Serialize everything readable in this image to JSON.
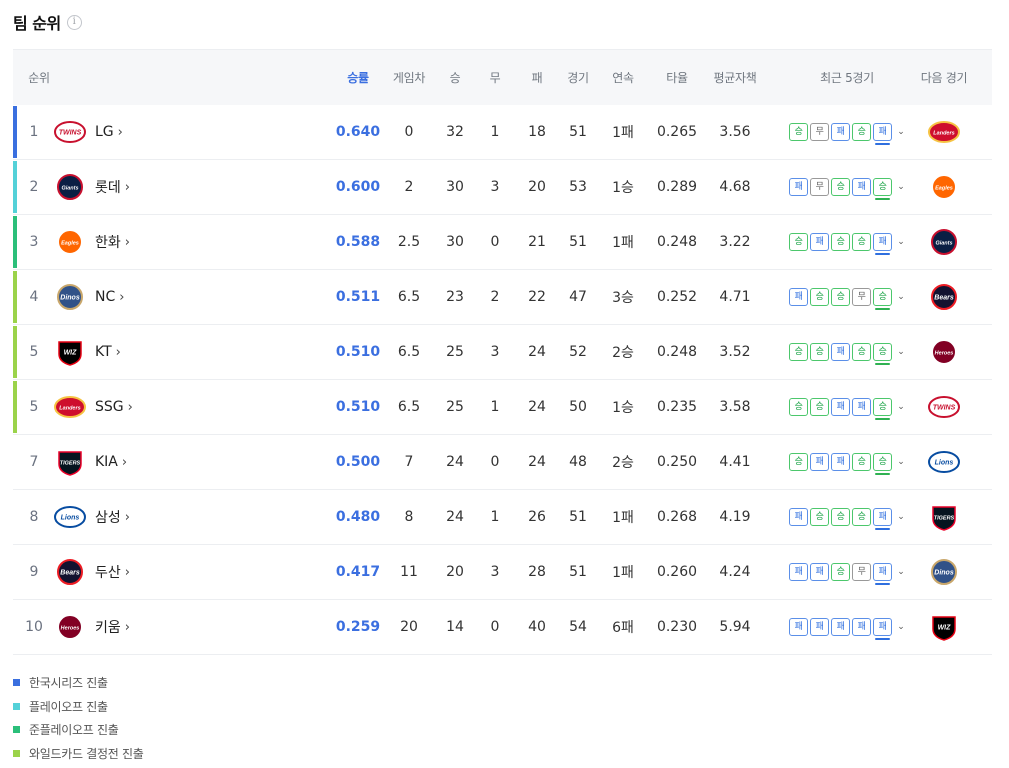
{
  "title": "팀 순위",
  "info_icon": "i",
  "colors": {
    "korean_series": "#3a6fdf",
    "playoff": "#54d1d8",
    "semi_playoff": "#2bbf7a",
    "wildcard": "#9bd34a",
    "win": "#1fa64a",
    "lose": "#2f6fdf",
    "draw": "#666666",
    "accent": "#3b6fe0"
  },
  "headers": {
    "rank": "순위",
    "pct": "승률",
    "gb": "게임차",
    "win": "승",
    "draw": "무",
    "lose": "패",
    "games": "경기",
    "streak": "연속",
    "avg": "타율",
    "era": "평균자책",
    "last5": "최근 5경기",
    "next": "다음 경기"
  },
  "rows": [
    {
      "rank": "1",
      "team": "LG",
      "pct": "0.640",
      "gb": "0",
      "w": "32",
      "d": "1",
      "l": "18",
      "g": "51",
      "streak": "1패",
      "avg": "0.265",
      "era": "3.56",
      "last5": [
        "승",
        "무",
        "패",
        "승",
        "패"
      ],
      "logo": "lg-twins-logo-icon",
      "next_logo": "ssg-landers-logo-icon",
      "bar": "korean_series"
    },
    {
      "rank": "2",
      "team": "롯데",
      "pct": "0.600",
      "gb": "2",
      "w": "30",
      "d": "3",
      "l": "20",
      "g": "53",
      "streak": "1승",
      "avg": "0.289",
      "era": "4.68",
      "last5": [
        "패",
        "무",
        "승",
        "패",
        "승"
      ],
      "logo": "lotte-giants-logo-icon",
      "next_logo": "hanwha-eagles-logo-icon",
      "bar": "playoff"
    },
    {
      "rank": "3",
      "team": "한화",
      "pct": "0.588",
      "gb": "2.5",
      "w": "30",
      "d": "0",
      "l": "21",
      "g": "51",
      "streak": "1패",
      "avg": "0.248",
      "era": "3.22",
      "last5": [
        "승",
        "패",
        "승",
        "승",
        "패"
      ],
      "logo": "hanwha-eagles-logo-icon",
      "next_logo": "lotte-giants-logo-icon",
      "bar": "semi_playoff"
    },
    {
      "rank": "4",
      "team": "NC",
      "pct": "0.511",
      "gb": "6.5",
      "w": "23",
      "d": "2",
      "l": "22",
      "g": "47",
      "streak": "3승",
      "avg": "0.252",
      "era": "4.71",
      "last5": [
        "패",
        "승",
        "승",
        "무",
        "승"
      ],
      "logo": "nc-dinos-logo-icon",
      "next_logo": "doosan-bears-logo-icon",
      "bar": "wildcard"
    },
    {
      "rank": "5",
      "team": "KT",
      "pct": "0.510",
      "gb": "6.5",
      "w": "25",
      "d": "3",
      "l": "24",
      "g": "52",
      "streak": "2승",
      "avg": "0.248",
      "era": "3.52",
      "last5": [
        "승",
        "승",
        "패",
        "승",
        "승"
      ],
      "logo": "kt-wiz-logo-icon",
      "next_logo": "kiwoom-heroes-logo-icon",
      "bar": "wildcard"
    },
    {
      "rank": "5",
      "team": "SSG",
      "pct": "0.510",
      "gb": "6.5",
      "w": "25",
      "d": "1",
      "l": "24",
      "g": "50",
      "streak": "1승",
      "avg": "0.235",
      "era": "3.58",
      "last5": [
        "승",
        "승",
        "패",
        "패",
        "승"
      ],
      "logo": "ssg-landers-logo-icon",
      "next_logo": "lg-twins-logo-icon",
      "bar": "wildcard"
    },
    {
      "rank": "7",
      "team": "KIA",
      "pct": "0.500",
      "gb": "7",
      "w": "24",
      "d": "0",
      "l": "24",
      "g": "48",
      "streak": "2승",
      "avg": "0.250",
      "era": "4.41",
      "last5": [
        "승",
        "패",
        "패",
        "승",
        "승"
      ],
      "logo": "kia-tigers-logo-icon",
      "next_logo": "samsung-lions-logo-icon",
      "bar": ""
    },
    {
      "rank": "8",
      "team": "삼성",
      "pct": "0.480",
      "gb": "8",
      "w": "24",
      "d": "1",
      "l": "26",
      "g": "51",
      "streak": "1패",
      "avg": "0.268",
      "era": "4.19",
      "last5": [
        "패",
        "승",
        "승",
        "승",
        "패"
      ],
      "logo": "samsung-lions-logo-icon",
      "next_logo": "kia-tigers-logo-icon",
      "bar": ""
    },
    {
      "rank": "9",
      "team": "두산",
      "pct": "0.417",
      "gb": "11",
      "w": "20",
      "d": "3",
      "l": "28",
      "g": "51",
      "streak": "1패",
      "avg": "0.260",
      "era": "4.24",
      "last5": [
        "패",
        "패",
        "승",
        "무",
        "패"
      ],
      "logo": "doosan-bears-logo-icon",
      "next_logo": "nc-dinos-logo-icon",
      "bar": ""
    },
    {
      "rank": "10",
      "team": "키움",
      "pct": "0.259",
      "gb": "20",
      "w": "14",
      "d": "0",
      "l": "40",
      "g": "54",
      "streak": "6패",
      "avg": "0.230",
      "era": "5.94",
      "last5": [
        "패",
        "패",
        "패",
        "패",
        "패"
      ],
      "logo": "kiwoom-heroes-logo-icon",
      "next_logo": "kt-wiz-logo-icon",
      "bar": ""
    }
  ],
  "legend": [
    {
      "label": "한국시리즈 진출",
      "color": "korean_series"
    },
    {
      "label": "플레이오프 진출",
      "color": "playoff"
    },
    {
      "label": "준플레이오프 진출",
      "color": "semi_playoff"
    },
    {
      "label": "와일드카드 결정전 진출",
      "color": "wildcard"
    }
  ]
}
